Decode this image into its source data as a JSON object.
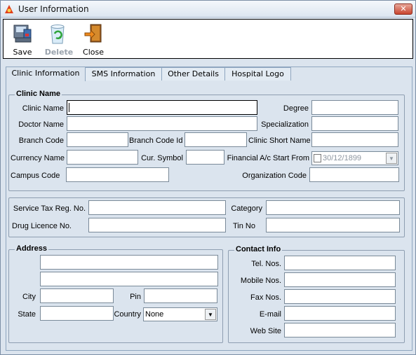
{
  "window": {
    "title": "User Information",
    "close_label": "✕"
  },
  "toolbar": {
    "save": "Save",
    "delete": "Delete",
    "close": "Close"
  },
  "tabs": [
    "Clinic Information",
    "SMS Information",
    "Other Details",
    "Hospital Logo"
  ],
  "clinic": {
    "legend": "Clinic Name",
    "clinic_name": "Clinic Name",
    "degree": "Degree",
    "doctor_name": "Doctor Name",
    "specialization": "Specialization",
    "branch_code": "Branch Code",
    "branch_code_id": "Branch Code Id",
    "clinic_short_name": "Clinic Short Name",
    "currency_name": "Currency Name",
    "cur_symbol": "Cur. Symbol",
    "fin_start": "Financial A/c Start From",
    "fin_start_value": "30/12/1899",
    "campus_code": "Campus Code",
    "org_code": "Organization Code"
  },
  "tax": {
    "service_tax": "Service Tax Reg. No.",
    "category": "Category",
    "drug_licence": "Drug Licence No.",
    "tin": "Tin No"
  },
  "address": {
    "legend": "Address",
    "city": "City",
    "pin": "Pin",
    "state": "State",
    "country": "Country",
    "country_value": "None"
  },
  "contact": {
    "legend": "Contact Info",
    "tel": "Tel. Nos.",
    "mobile": "Mobile Nos.",
    "fax": "Fax Nos.",
    "email": "E-mail",
    "web": "Web Site"
  },
  "colors": {
    "window_bg": "#dbe4ee",
    "close_red": "#c8452f"
  }
}
